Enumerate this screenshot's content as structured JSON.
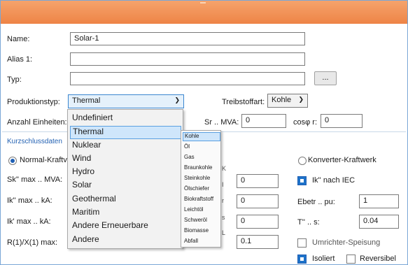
{
  "form": {
    "name_label": "Name:",
    "name_value": "Solar-1",
    "alias_label": "Alias 1:",
    "alias_value": "",
    "typ_label": "Typ:",
    "typ_value": "",
    "typ_button": "...",
    "produktionstyp_label": "Produktionstyp:",
    "produktionstyp_value": "Thermal",
    "treibstoffart_label": "Treibstoffart:",
    "treibstoffart_value": "Kohle",
    "anzahl_label": "Anzahl Einheiten:",
    "sr_label": "Sr .. MVA:",
    "sr_value": "0",
    "cosphi_label": "cosφ r:",
    "cosphi_value": "0"
  },
  "kurzschluss": {
    "section_link": "Kurzschlussdaten",
    "radio_normal": "Normal-Kraftv",
    "radio_konverter": "Konverter-Kraftwerk",
    "sk_label": "Sk'' max .. MVA:",
    "ik_max_label": "Ik'' max .. kA:",
    "ik_prime_label": "Ik' max .. kA:",
    "r1x1_label": "R(1)/X(1) max:",
    "col_values": [
      "0",
      "0",
      "0",
      "0.1"
    ],
    "ik_iec_label": "Ik'' nach IEC",
    "ebetr_label": "Ebetr .. pu:",
    "ebetr_value": "1",
    "t_label": "T'' .. s:",
    "t_value": "0.04",
    "umrichter_label": "Umrichter-Speisung",
    "isoliert_label": "Isoliert",
    "reversibel_label": "Reversibel"
  },
  "produktionstyp_options": [
    "Undefiniert",
    "Thermal",
    "Nuklear",
    "Wind",
    "Hydro",
    "Solar",
    "Geothermal",
    "Maritim",
    "Andere Erneuerbare",
    "Andere"
  ],
  "treibstoff_options": [
    "Kohle",
    "Öl",
    "Gas",
    "Braunkohle",
    "Steinkohle",
    "Ölschiefer",
    "Biokraftstoff",
    "Leichtöl",
    "Schweröl",
    "Biomasse",
    "Abfall"
  ],
  "colors": {
    "header": "#ee8446",
    "accent": "#1e72c9",
    "link": "#2462b3"
  }
}
